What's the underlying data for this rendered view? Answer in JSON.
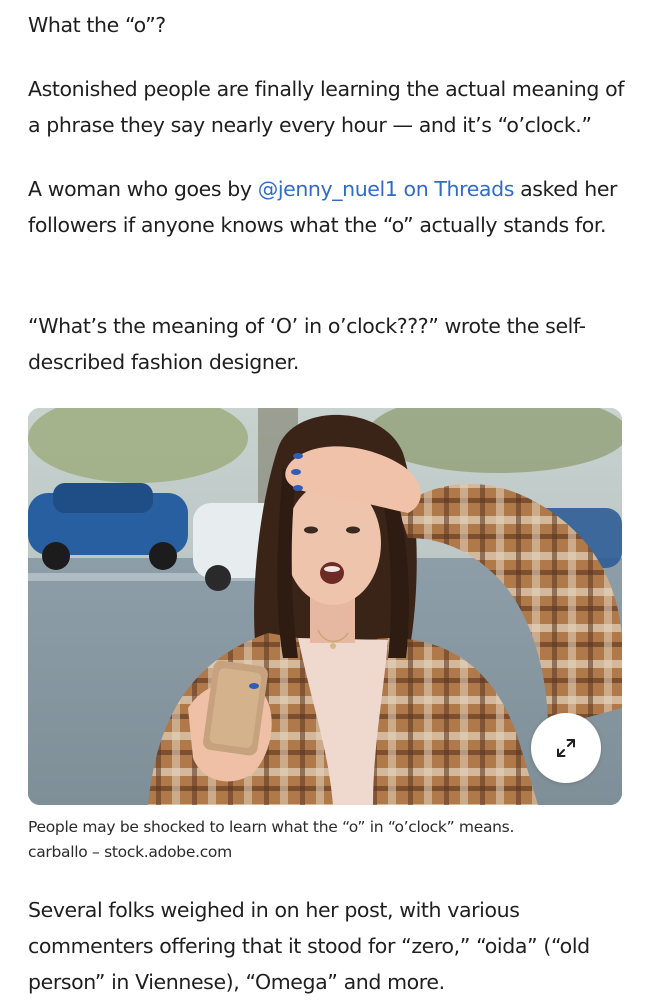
{
  "article": {
    "para1": "What the “o”?",
    "para2": "Astonished people are finally learning the actual meaning of a phrase they say nearly every hour — and it’s “o’clock.”",
    "para3_before": "A woman who goes by ",
    "para3_link": "@jenny_nuel1 on Threads",
    "para3_after": " asked her followers if anyone knows what the “o” actually stands for.",
    "para4": "“What’s the meaning of ‘O’ in o’clock???” wrote the self-described fashion designer.",
    "para5": "Several folks weighed in on her post, with various commenters offering that it stood for “zero,” “oida” (“old person” in Viennese), “Omega” and more."
  },
  "figure": {
    "caption": "People may be shocked to learn what the “o” in “o’clock” means.",
    "credit": "carballo – stock.adobe.com",
    "expand_icon": "expand-arrows-icon"
  },
  "colors": {
    "link": "#2f6cc9",
    "text": "#1f1f1f"
  }
}
